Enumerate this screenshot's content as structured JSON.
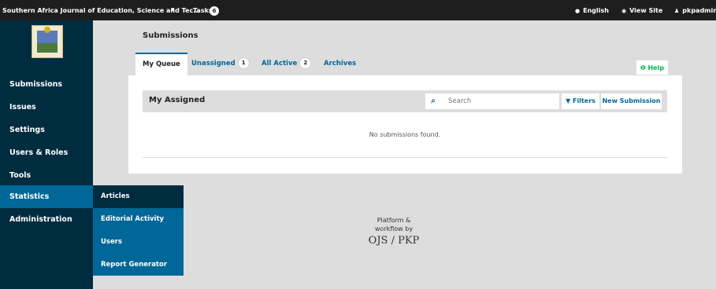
{
  "topbar": {
    "context": "Southern Africa Journal of Education, Science and Tec...",
    "tasks_label": "Tasks",
    "tasks_count": "6",
    "language": "English",
    "view_site": "View Site",
    "user": "pkpadmin"
  },
  "sidebar": {
    "items": [
      {
        "label": "Submissions"
      },
      {
        "label": "Issues"
      },
      {
        "label": "Settings"
      },
      {
        "label": "Users & Roles"
      },
      {
        "label": "Tools"
      },
      {
        "label": "Statistics"
      },
      {
        "label": "Administration"
      }
    ],
    "flyout": [
      {
        "label": "Articles"
      },
      {
        "label": "Editorial Activity"
      },
      {
        "label": "Users"
      },
      {
        "label": "Report Generator"
      }
    ]
  },
  "page": {
    "title": "Submissions",
    "tabs": [
      {
        "label": "My Queue"
      },
      {
        "label": "Unassigned",
        "count": "1"
      },
      {
        "label": "All Active",
        "count": "2"
      },
      {
        "label": "Archives"
      }
    ],
    "help_label": "Help"
  },
  "grid": {
    "title": "My Assigned",
    "search_placeholder": "Search",
    "filters_label": "Filters",
    "new_label": "New Submission",
    "empty": "No submissions found."
  },
  "footer": {
    "line1": "Platform &",
    "line2": "workflow by",
    "logo": "OJS / PKP"
  },
  "colors": {
    "sidebar": "#002c40",
    "accent": "#006798",
    "help": "#00b24e",
    "topbar": "#1e1e1e"
  },
  "icons": [
    "chevron-down-icon",
    "globe-icon",
    "eye-icon",
    "user-icon",
    "help-icon",
    "search-icon",
    "filter-icon"
  ]
}
